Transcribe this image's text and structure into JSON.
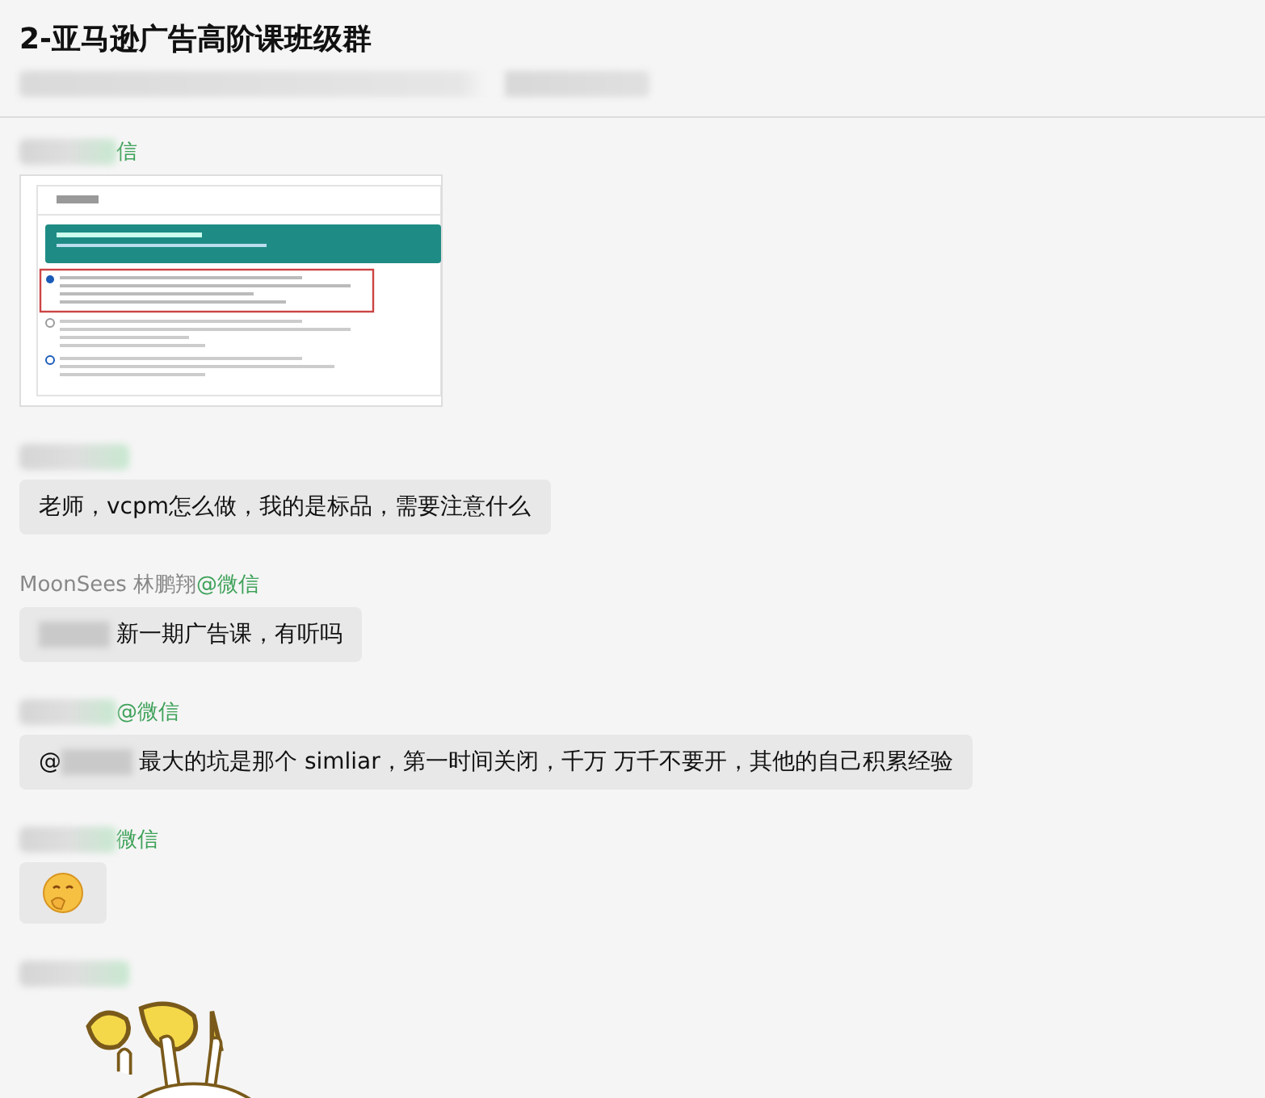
{
  "header": {
    "title": "2-亚马逊广告高阶课班级群",
    "subtitle_blurred": true
  },
  "messages": [
    {
      "kind": "image",
      "sender": {
        "blurred": true,
        "suffix": "信"
      }
    },
    {
      "kind": "text",
      "sender": {
        "blurred": true
      },
      "mention_blurred": false,
      "text": "老师，vcpm怎么做，我的是标品，需要注意什么"
    },
    {
      "kind": "text",
      "sender": {
        "blurred": false,
        "name": "MoonSees 林鹏翔",
        "suffix": "@微信"
      },
      "mention_blurred": true,
      "text": "新一期广告课，有听吗"
    },
    {
      "kind": "text",
      "sender": {
        "blurred": true,
        "suffix": "@微信"
      },
      "prefix": "@",
      "mention_blurred": true,
      "text": "最大的坑是那个 simliar，第一时间关闭，千万 万千不要开，其他的自己积累经验"
    },
    {
      "kind": "emoji",
      "sender": {
        "blurred": true,
        "suffix": "微信"
      }
    },
    {
      "kind": "sticker",
      "sender": {
        "blurred": true
      }
    }
  ]
}
